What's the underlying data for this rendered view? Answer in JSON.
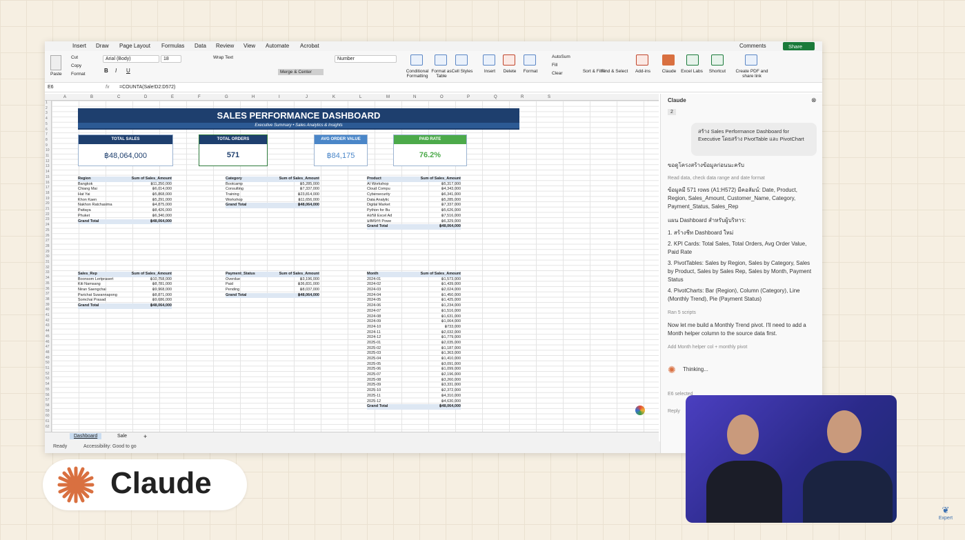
{
  "menu": [
    "Insert",
    "Draw",
    "Page Layout",
    "Formulas",
    "Data",
    "Review",
    "View",
    "Automate",
    "Acrobat"
  ],
  "comments": "Comments",
  "share": "Share",
  "ribbon": {
    "paste": "Paste",
    "cut": "Cut",
    "copy": "Copy",
    "format": "Format",
    "font": "Arial (Body)",
    "size": "18",
    "wrap": "Wrap Text",
    "merge": "Merge & Center",
    "number": "Number",
    "cond": "Conditional Formatting",
    "fmt_table": "Format as Table",
    "cell_styles": "Cell Styles",
    "insert": "Insert",
    "delete": "Delete",
    "format2": "Format",
    "autosum": "AutoSum",
    "fill": "Fill",
    "clear": "Clear",
    "sort": "Sort & Filter",
    "find": "Find & Select",
    "addins": "Add-ins",
    "claude": "Claude",
    "excel_labs": "Excel Labs",
    "shortcut": "Shortcut",
    "pdf": "Create PDF and share link"
  },
  "formula": {
    "cell": "E6",
    "text": "=COUNTA(Sale!D2:D572)"
  },
  "cols": [
    "A",
    "B",
    "C",
    "D",
    "E",
    "F",
    "G",
    "H",
    "I",
    "J",
    "K",
    "L",
    "M",
    "N",
    "O",
    "P",
    "Q",
    "R",
    "S"
  ],
  "dashboard": {
    "title": "SALES PERFORMANCE DASHBOARD",
    "subtitle": "Executive Summary  •  Sales Analytics & Insights"
  },
  "kpis": [
    {
      "label": "TOTAL SALES",
      "value": "฿48,064,000",
      "color": "#1e3f6e"
    },
    {
      "label": "TOTAL ORDERS",
      "value": "571",
      "color": "#1e3f6e"
    },
    {
      "label": "AVG ORDER VALUE",
      "value": "฿84,175",
      "color": "#4a86c8"
    },
    {
      "label": "PAID RATE",
      "value": "76.2%",
      "color": "#4caa4a"
    }
  ],
  "pivots": {
    "region": {
      "h1": "Region",
      "h2": "Sum of Sales_Amount",
      "rows": [
        [
          "Bangkok",
          "฿11,250,000"
        ],
        [
          "Chiang Mai",
          "฿6,014,000"
        ],
        [
          "Hat Yai",
          "฿5,868,000"
        ],
        [
          "Khon Kaen",
          "฿5,291,000"
        ],
        [
          "Nakhon Ratchasima",
          "฿4,875,000"
        ],
        [
          "Pattaya",
          "฿8,426,000"
        ],
        [
          "Phuket",
          "฿6,340,000"
        ]
      ],
      "total": [
        "Grand Total",
        "฿48,064,000"
      ]
    },
    "category": {
      "h1": "Category",
      "h2": "Sum of Sales_Amount",
      "rows": [
        [
          "Bootcamp",
          "฿5,285,000"
        ],
        [
          "Consulting",
          "฿7,337,000"
        ],
        [
          "Training",
          "฿23,814,000"
        ],
        [
          "Workshop",
          "฿11,656,000"
        ]
      ],
      "total": [
        "Grand Total",
        "฿48,064,000"
      ]
    },
    "product": {
      "h1": "Product",
      "h2": "Sum of Sales_Amount",
      "rows": [
        [
          "AI Workshop",
          "฿5,317,000"
        ],
        [
          "Cloud Compu",
          "฿4,343,000"
        ],
        [
          "Cybersecurity",
          "฿6,341,000"
        ],
        [
          "Data Analytic",
          "฿5,285,000"
        ],
        [
          "Digital Market",
          "฿7,337,000"
        ],
        [
          "Python for Bu",
          "฿5,626,000"
        ],
        [
          "คอร์ส Excel Ad",
          "฿7,516,000"
        ],
        [
          "มหัศจรร Powe",
          "฿6,329,000"
        ]
      ],
      "total": [
        "Grand Total",
        "฿48,064,000"
      ]
    },
    "rep": {
      "h1": "Sales_Rep",
      "h2": "Sum of Sales_Amount",
      "rows": [
        [
          "Boonsom Lertprasert",
          "฿10,758,000"
        ],
        [
          "Kiti Namsang",
          "฿8,781,000"
        ],
        [
          "Niran Saengchai",
          "฿9,968,000"
        ],
        [
          "Parichat Suwannapong",
          "฿8,871,000"
        ],
        [
          "Somchai Prasad",
          "฿9,686,000"
        ]
      ],
      "total": [
        "Grand Total",
        "฿48,064,000"
      ]
    },
    "payment": {
      "h1": "Payment_Status",
      "h2": "Sum of Sales_Amount",
      "rows": [
        [
          "Overdue",
          "฿3,196,000"
        ],
        [
          "Paid",
          "฿36,831,000"
        ],
        [
          "Pending",
          "฿8,037,000"
        ]
      ],
      "total": [
        "Grand Total",
        "฿48,064,000"
      ]
    },
    "month": {
      "h1": "Month",
      "h2": "Sum of Sales_Amount",
      "rows": [
        [
          "2024-01",
          "฿1,573,000"
        ],
        [
          "2024-02",
          "฿1,439,000"
        ],
        [
          "2024-03",
          "฿2,024,000"
        ],
        [
          "2024-04",
          "฿1,450,000"
        ],
        [
          "2024-05",
          "฿1,425,000"
        ],
        [
          "2024-06",
          "฿1,234,000"
        ],
        [
          "2024-07",
          "฿1,516,000"
        ],
        [
          "2024-08",
          "฿1,631,000"
        ],
        [
          "2024-09",
          "฿1,064,000"
        ],
        [
          "2024-10",
          "฿733,000"
        ],
        [
          "2024-11",
          "฿2,032,000"
        ],
        [
          "2024-12",
          "฿1,779,000"
        ],
        [
          "2025-01",
          "฿2,035,000"
        ],
        [
          "2025-02",
          "฿1,187,000"
        ],
        [
          "2025-03",
          "฿1,363,000"
        ],
        [
          "2025-04",
          "฿1,410,000"
        ],
        [
          "2025-05",
          "฿3,091,000"
        ],
        [
          "2025-06",
          "฿1,099,000"
        ],
        [
          "2025-07",
          "฿2,196,000"
        ],
        [
          "2025-08",
          "฿3,260,000"
        ],
        [
          "2025-09",
          "฿3,331,000"
        ],
        [
          "2025-10",
          "฿2,372,000"
        ],
        [
          "2025-11",
          "฿4,310,000"
        ],
        [
          "2025-12",
          "฿4,630,000"
        ]
      ],
      "total": [
        "Grand Total",
        "฿48,064,000"
      ]
    }
  },
  "tabs": [
    "Dashboard",
    "Sale"
  ],
  "status": {
    "ready": "Ready",
    "access": "Accessibility: Good to go"
  },
  "claude_panel": {
    "title": "Claude",
    "badge": "2",
    "user_msg": "สร้าง Sales Performance Dashboard for Executive โดยสร้าง PivotTable และ PivotChart",
    "l1": "ขอดูโครงสร้างข้อมูลก่อนนะครับ",
    "l2": "Read data, check data range and date format",
    "l3": "ข้อมูลมี 571 rows (A1:H572) มีคอลัมน์: Date, Product, Region, Sales_Amount, Customer_Name, Category, Payment_Status, Sales_Rep",
    "l4": "แผน Dashboard สำหรับผู้บริหาร:",
    "steps": [
      "1.  สร้างชีท Dashboard ใหม่",
      "2.  KPI Cards: Total Sales, Total Orders, Avg Order Value, Paid Rate",
      "3.  PivotTables: Sales by Region, Sales by Category, Sales by Product, Sales by Sales Rep, Sales by Month, Payment Status",
      "4.  PivotCharts: Bar (Region), Column (Category), Line (Monthly Trend), Pie (Payment Status)"
    ],
    "l5": "Ran 5 scripts",
    "l6": "Now let me build a Monthly Trend pivot. I'll need to add a Month helper column to the source data first.",
    "l7": "Add Month helper col + monthly pivot",
    "thinking": "Thinking...",
    "selected": "E6 selected",
    "reply": "Reply"
  },
  "brand": "Claude",
  "expert": "Expert"
}
